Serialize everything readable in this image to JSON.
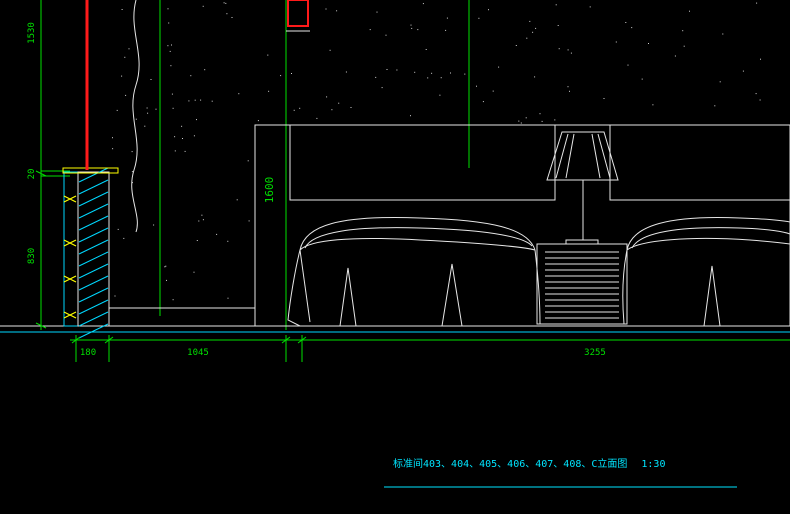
{
  "drawing": {
    "title": "标准间403、404、405、406、407、408、C立面图",
    "scale": "1:30"
  },
  "dimensions": {
    "vertical": {
      "top": "1530",
      "mid": "20",
      "bottom": "830",
      "headboard_height": "1600"
    },
    "horizontal": {
      "wall": "180",
      "space": "1045",
      "furniture": "3255"
    }
  },
  "colors": {
    "background": "#000000",
    "line_white": "#e6e6e6",
    "dim_green": "#00e000",
    "section_red": "#ff1a1a",
    "wall_cyan": "#00d8ff",
    "hatch_yellow": "#ffff00",
    "text_cyan": "#00e5ff"
  }
}
